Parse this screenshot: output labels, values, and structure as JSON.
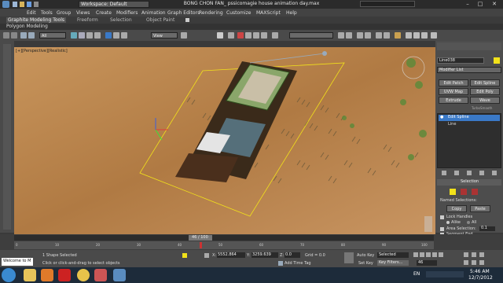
{
  "titlebar": {
    "workspace": "Workspace: Default",
    "title": "BONG CHON FAN_ pssicomagie house animation day.max"
  },
  "menubar": {
    "items": [
      "Edit",
      "Tools",
      "Group",
      "Views",
      "Create",
      "Modifiers",
      "Animation",
      "Graph Editors",
      "Rendering",
      "Customize",
      "MAXScript",
      "Help"
    ]
  },
  "ribbon": {
    "tabs": [
      "Graphite Modeling Tools",
      "Freeform",
      "Selection",
      "Object Paint"
    ],
    "subtab": "Polygon Modeling"
  },
  "toolbar": {
    "selection_filter": "All",
    "ref_coord": "View"
  },
  "viewport": {
    "label": "[+][Perspective][Realistic]"
  },
  "command_panel": {
    "object_name": "Line038",
    "modifier_list": "Modifier List",
    "buttons": [
      "Edit Patch",
      "Edit Spline",
      "UVW Map",
      "Edit Poly",
      "Extrude",
      "Wave"
    ],
    "subtitle": "TurboSmooth",
    "stack_items": [
      "Edit Spline",
      "Line"
    ],
    "selection_header": "Selection",
    "named_selections": "Named Selections:",
    "copy": "Copy",
    "paste": "Paste",
    "lock_handles": "Lock Handles",
    "alike": "Alike",
    "all": "All",
    "area_selection": "Area Selection:",
    "area_value": "0.1",
    "segment_end": "Segment End"
  },
  "timeline": {
    "frame": "46 / 100",
    "ticks": [
      "0",
      "10",
      "20",
      "30",
      "40",
      "50",
      "60",
      "70",
      "80",
      "90",
      "100"
    ]
  },
  "status": {
    "script_prompt": "Welcome to M",
    "selected": "1 Shape Selected",
    "hint": "Click or click-and-drag to select objects",
    "x_label": "X:",
    "x_value": "5552.864",
    "y_label": "Y:",
    "y_value": "3259.639",
    "z_label": "Z:",
    "z_value": "0.0",
    "grid": "Grid = 0.0",
    "auto_key": "Auto Key",
    "selected_dd": "Selected",
    "set_key": "Set Key",
    "key_filters": "Key Filters...",
    "add_time_tag": "Add Time Tag",
    "current_frame": "46"
  },
  "taskbar": {
    "lang": "EN",
    "time": "5:46 AM",
    "date": "12/7/2012"
  },
  "colors": {
    "ground": "#b8824d",
    "selection_yellow": "#f2e21a",
    "ui_dark": "#3a3a3a",
    "active_blue": "#3a79c7"
  }
}
